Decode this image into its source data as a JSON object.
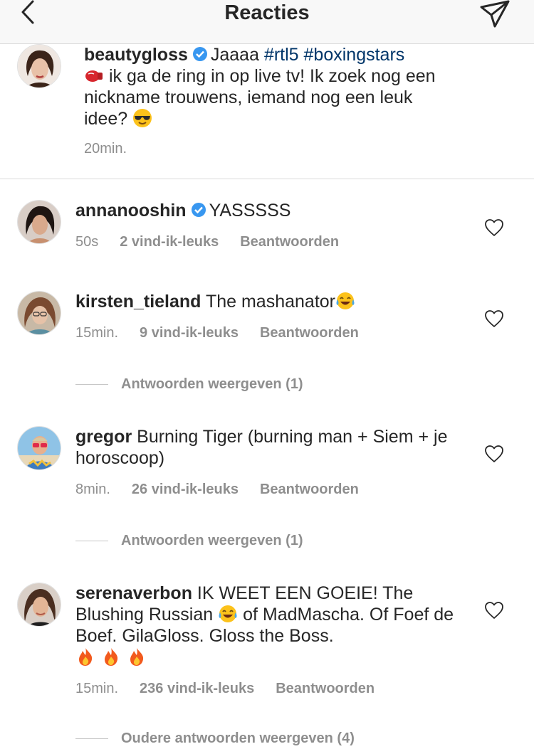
{
  "header": {
    "title": "Reacties",
    "back_icon": "chevron-left-icon",
    "send_icon": "paper-plane-icon"
  },
  "caption": {
    "username": "beautygloss",
    "text_intro": "Jaaaa ",
    "hashtag1": "#rtl5",
    "hashtag2": "#boxingstars",
    "text_body": " ik ga de ring in op live tv! Ik zoek nog een nickname trouwens, iemand nog een leuk idee? ",
    "time": "20min."
  },
  "comments": [
    {
      "username": "annanooshin",
      "text": "YASSSSS",
      "time": "50s",
      "likes": "2 vind-ik-leuks",
      "reply": "Beantwoorden"
    },
    {
      "username": "kirsten_tieland",
      "text": "The mashanator",
      "time": "15min.",
      "likes": "9 vind-ik-leuks",
      "reply": "Beantwoorden",
      "view_replies": "Antwoorden weergeven (1)"
    },
    {
      "username": "gregor",
      "text": "Burning Tiger (burning man + Siem + je horoscoop)",
      "time": "8min.",
      "likes": "26 vind-ik-leuks",
      "reply": "Beantwoorden",
      "view_replies": "Antwoorden weergeven (1)"
    },
    {
      "username": "serenaverbon",
      "text_a": "IK WEET EEN GOEIE! The Blushing Russian ",
      "text_b": " of MadMascha. Of Foef de Boef.  GilaGloss. Gloss the Boss.",
      "time": "15min.",
      "likes": "236 vind-ik-leuks",
      "reply": "Beantwoorden",
      "view_replies": "Oudere antwoorden weergeven (4)"
    }
  ],
  "colors": {
    "link": "#003569",
    "muted": "#8e8e8e",
    "verified": "#3897f0",
    "divider": "#dbdbdb"
  }
}
